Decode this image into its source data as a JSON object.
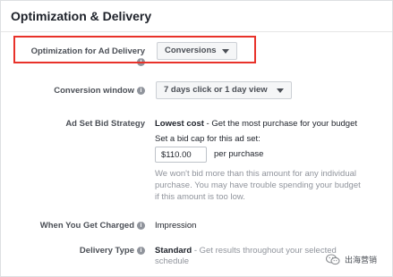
{
  "section": {
    "title": "Optimization & Delivery"
  },
  "optimization": {
    "label": "Optimization for Ad Delivery",
    "value": "Conversions"
  },
  "conversion_window": {
    "label": "Conversion window",
    "value": "7 days click or 1 day view"
  },
  "bid_strategy": {
    "label": "Ad Set Bid Strategy",
    "strategy": "Lowest cost",
    "description": " - Get the most purchase for your budget",
    "bid_cap_label": "Set a bid cap for this ad set:",
    "bid_cap_value": "$110.00",
    "bid_cap_suffix": "per purchase",
    "helper_lines": [
      "We won't bid more than this amount for any individual",
      "purchase. You may have trouble spending your budget",
      "if this amount is too low."
    ]
  },
  "charged": {
    "label": "When You Get Charged",
    "value": "Impression"
  },
  "delivery": {
    "label": "Delivery Type",
    "type": "Standard",
    "description_line1": " - Get results throughout your selected",
    "description_line2": "schedule"
  },
  "info_glyph": "i",
  "watermark": {
    "text": "出海营销",
    "icon": "wechat-icon"
  },
  "colors": {
    "highlight": "#e8322a",
    "label": "#4b4f56",
    "muted": "#90949c"
  }
}
